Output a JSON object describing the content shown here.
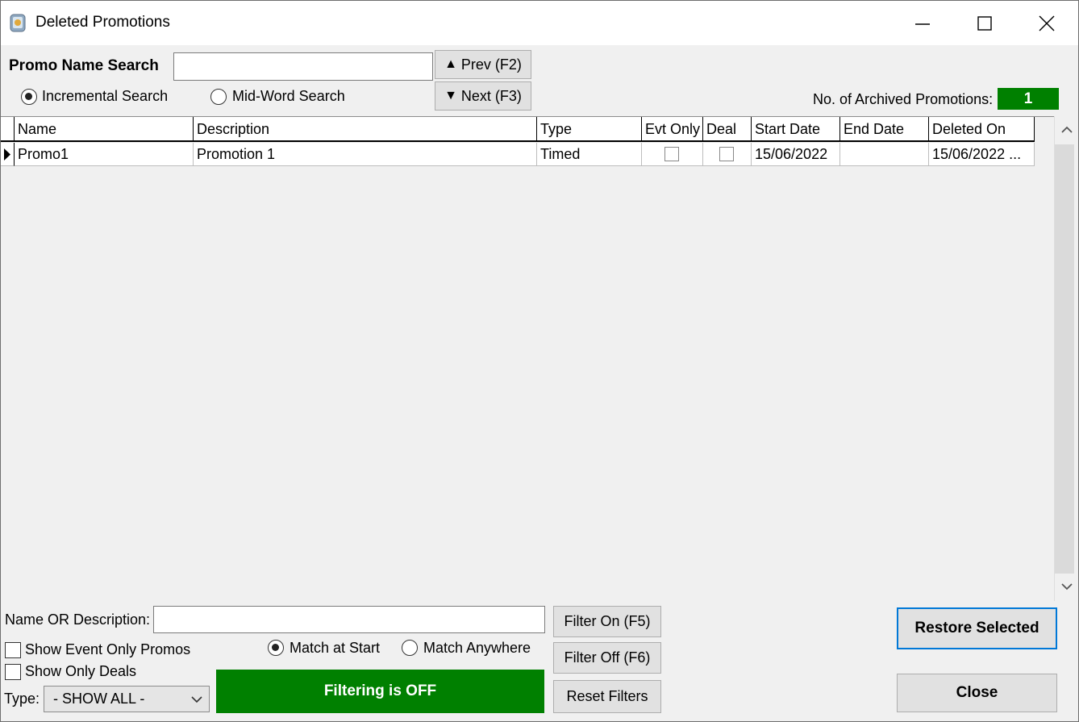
{
  "window": {
    "title": "Deleted Promotions",
    "controls": {
      "minimize_icon": "minimize-icon",
      "maximize_icon": "maximize-icon",
      "close_icon": "close-icon"
    }
  },
  "search": {
    "label": "Promo Name Search",
    "value": "",
    "prev_label": "Prev (F2)",
    "next_label": "Next (F3)",
    "mode_options": [
      {
        "label": "Incremental Search",
        "selected": true
      },
      {
        "label": "Mid-Word Search",
        "selected": false
      }
    ]
  },
  "archive_count": {
    "label": "No. of Archived Promotions:",
    "value": "1",
    "color": "#008000"
  },
  "grid": {
    "columns": [
      "Name",
      "Description",
      "Type",
      "Evt Only",
      "Deal",
      "Start Date",
      "End Date",
      "Deleted On"
    ],
    "rows": [
      {
        "name": "Promo1",
        "description": "Promotion 1",
        "type": "Timed",
        "evt_only": false,
        "deal": false,
        "start_date": "15/06/2022",
        "end_date": "",
        "deleted_on": "15/06/2022 ..."
      }
    ]
  },
  "filters": {
    "name_or_description_label": "Name OR Description:",
    "name_or_description_value": "",
    "show_event_only_label": "Show Event Only Promos",
    "show_event_only_checked": false,
    "show_only_deals_label": "Show Only Deals",
    "show_only_deals_checked": false,
    "type_label": "Type:",
    "type_value": "- SHOW ALL -",
    "match_options": [
      {
        "label": "Match at Start",
        "selected": true
      },
      {
        "label": "Match Anywhere",
        "selected": false
      }
    ],
    "filter_on_label": "Filter On (F5)",
    "filter_off_label": "Filter Off (F6)",
    "reset_label": "Reset Filters",
    "status": "Filtering is OFF",
    "status_color": "#008000"
  },
  "actions": {
    "restore_label": "Restore Selected",
    "close_label": "Close"
  }
}
